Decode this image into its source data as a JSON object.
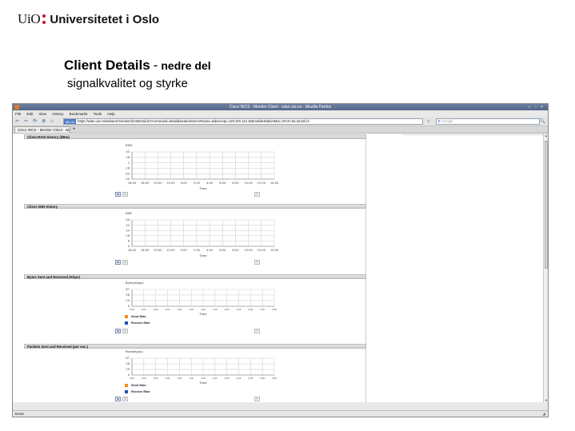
{
  "slide": {
    "logo_mark": "UiO",
    "logo_name": "Universitetet i Oslo",
    "title": "Client Details",
    "title_separator": "-",
    "title_suffix": "nedre del",
    "subtitle": "signalkvalitet og styrke"
  },
  "browser": {
    "window_title": "Cisco WCS - Monitor Client - wlan.uio.no - Mozilla Firefox",
    "window_controls": "– ▫ ×",
    "menu": [
      "File",
      "Edit",
      "View",
      "History",
      "Bookmarks",
      "Tools",
      "Help"
    ],
    "nav_icons": [
      "back-icon",
      "forward-icon",
      "reload-icon",
      "stop-icon",
      "home-icon"
    ],
    "nav_glyphs": [
      "⇦",
      "⇨",
      "⟳",
      "⊗",
      "⌂"
    ],
    "url_site": "uio.no",
    "url": "https://wlan.uio.no/webacs/monitorClientDetail.do?command=detail&locationServerName=&deviceIp=129.240.112.18&mobileStationMac=00:21:6a:4a:6d:c4",
    "bookmark_star": "☆",
    "search_engine": "G",
    "search_placeholder": "Google",
    "search_icon": "🔍",
    "tab_label": "Cisco WCS - Monitor Client - wla...",
    "tab_add": "+",
    "status": "Done",
    "scroll_up": "▲",
    "scroll_down": "▼",
    "resize_grip": "◢"
  },
  "panels": {
    "rssi": {
      "title": "Client RSSI History (dBm)",
      "ylabel": "RSSI",
      "xlabel": "Time",
      "btn_a": "⇆",
      "btn_b": "⊞",
      "btn_c": "⇱"
    },
    "snr": {
      "title": "Client SNR History",
      "ylabel": "SNR",
      "xlabel": "Time",
      "btn_a": "⇆",
      "btn_b": "⊞",
      "btn_c": "⇱"
    },
    "bytes": {
      "title": "Bytes Sent and Received (Kbps)",
      "ylabel": "Bytes(kbps)",
      "xlabel": "Time",
      "legend_send": "Send Rate",
      "legend_receive": "Receive Rate",
      "btn_a": "⇆",
      "btn_b": "⊞",
      "btn_c": "⇱"
    },
    "packets": {
      "title": "Packets Sent and Received (per sec.)",
      "ylabel": "Packets(ps)",
      "xlabel": "Time",
      "legend_send": "Send Rate",
      "legend_receive": "Receive Rate",
      "btn_a": "⇆",
      "btn_b": "⊞",
      "btn_c": "⇱"
    }
  },
  "colors": {
    "send": "#f28c1c",
    "receive": "#1f4fb0",
    "grid": "#c9c9c9",
    "logo_dot": "#c8102e"
  },
  "chart_data": [
    {
      "type": "line",
      "title": "Client RSSI History (dBm)",
      "ylabel": "RSSI",
      "xlabel": "Time",
      "yticks": [
        "35",
        "18",
        "1",
        "-16",
        "-33",
        "-50"
      ],
      "ylim": [
        -50,
        35
      ],
      "categories": [
        "16:00",
        "18:00",
        "20:00",
        "22:00",
        "0:00",
        "2:00",
        "4:00",
        "6:00",
        "8:00",
        "10:00",
        "12:00",
        "14:00"
      ],
      "series": [],
      "grid": true
    },
    {
      "type": "line",
      "title": "Client SNR History",
      "ylabel": "SNR",
      "xlabel": "Time",
      "yticks": [
        "40",
        "32",
        "24",
        "16",
        "8",
        "0"
      ],
      "ylim": [
        0,
        40
      ],
      "categories": [
        "16:00",
        "18:00",
        "20:00",
        "22:00",
        "0:00",
        "2:00",
        "4:00",
        "6:00",
        "8:00",
        "10:00",
        "12:00",
        "14:00"
      ],
      "series": [],
      "grid": true
    },
    {
      "type": "line",
      "title": "Bytes Sent and Received (Kbps)",
      "ylabel": "Bytes(kbps)",
      "xlabel": "Time",
      "yticks": [
        "87",
        "58",
        "29",
        "0"
      ],
      "ylim": [
        0,
        87
      ],
      "categories": [
        "0:00",
        "0:00",
        "0:00",
        "0:00",
        "1:00",
        "1:00",
        "1:00",
        "1:00",
        "0:00",
        "0:00",
        "0:00",
        "0:00",
        "0:00"
      ],
      "series": [
        {
          "name": "Send Rate",
          "values": []
        },
        {
          "name": "Receive Rate",
          "values": []
        }
      ],
      "grid": true
    },
    {
      "type": "line",
      "title": "Packets Sent and Received (per sec.)",
      "ylabel": "Packets(ps)",
      "xlabel": "Time",
      "yticks": [
        "87",
        "58",
        "29",
        "0"
      ],
      "ylim": [
        0,
        87
      ],
      "categories": [
        "0:00",
        "0:00",
        "0:00",
        "0:00",
        "1:00",
        "1:00",
        "1:00",
        "1:00",
        "0:00",
        "0:00",
        "0:00",
        "0:00",
        "0:00"
      ],
      "series": [
        {
          "name": "Send Rate",
          "values": []
        },
        {
          "name": "Receive Rate",
          "values": []
        }
      ],
      "grid": true
    }
  ]
}
